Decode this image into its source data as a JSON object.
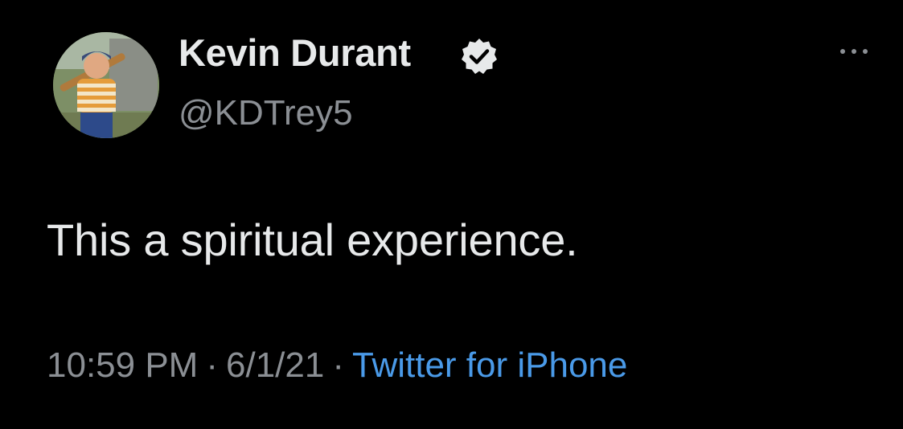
{
  "tweet": {
    "display_name": "Kevin Durant",
    "handle": "@KDTrey5",
    "text": "This a spiritual experience.",
    "time": "10:59 PM",
    "separator": "·",
    "date": "6/1/21",
    "source": "Twitter for iPhone"
  },
  "icons": {
    "verified": "verified-badge-icon",
    "more": "more-options-icon"
  },
  "colors": {
    "background": "#000000",
    "primary_text": "#e7e9ea",
    "secondary_text": "#8b8f94",
    "link": "#4a9ae8"
  }
}
